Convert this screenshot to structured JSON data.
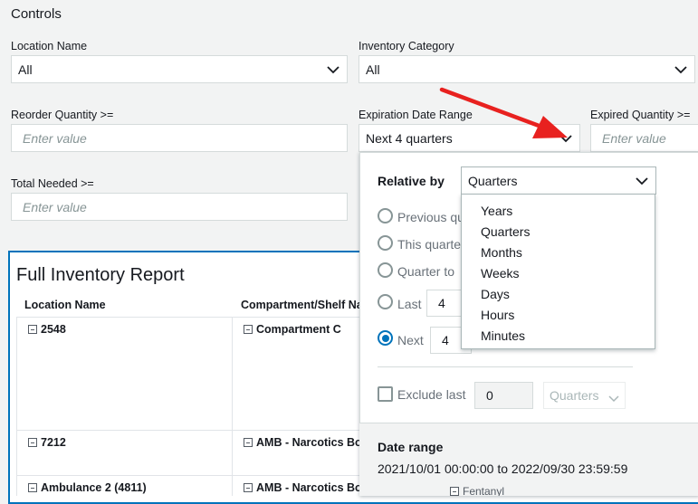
{
  "controls": {
    "title": "Controls",
    "location_name": {
      "label": "Location Name",
      "value": "All"
    },
    "inventory_category": {
      "label": "Inventory Category",
      "value": "All"
    },
    "reorder_quantity": {
      "label": "Reorder Quantity >=",
      "placeholder": "Enter value"
    },
    "expiration_date_range": {
      "label": "Expiration Date Range",
      "value": "Next 4 quarters"
    },
    "expired_quantity": {
      "label": "Expired Quantity >=",
      "placeholder": "Enter value"
    },
    "total_needed": {
      "label": "Total Needed >=",
      "placeholder": "Enter value"
    }
  },
  "report": {
    "title": "Full Inventory Report",
    "columns": [
      "Location Name",
      "Compartment/Shelf Na"
    ],
    "rows": [
      {
        "location": "2548",
        "compartment": "Compartment C"
      },
      {
        "location": "7212",
        "compartment": "AMB - Narcotics Box"
      },
      {
        "location": "Ambulance 2 (4811)",
        "compartment": "AMB - Narcotics Box"
      }
    ],
    "partial_cell": "Fentanyl"
  },
  "popover": {
    "relative_by_label": "Relative by",
    "relative_by_value": "Quarters",
    "options": {
      "previous": "Previous qu",
      "this": "This quarte",
      "to_date": "Quarter to",
      "last": "Last",
      "next": "Next"
    },
    "last_value": "4",
    "next_value": "4",
    "selected_option": "next",
    "exclude_last_label": "Exclude last",
    "exclude_value": "0",
    "exclude_unit": "Quarters",
    "date_range_label": "Date range",
    "date_range_value": "2021/10/01 00:00:00 to 2022/09/30 23:59:59"
  },
  "relative_by_options": [
    "Years",
    "Quarters",
    "Months",
    "Weeks",
    "Days",
    "Hours",
    "Minutes"
  ],
  "colors": {
    "accent": "#0073bb",
    "annotation_arrow": "#e8211f",
    "background": "#f2f3f3"
  }
}
